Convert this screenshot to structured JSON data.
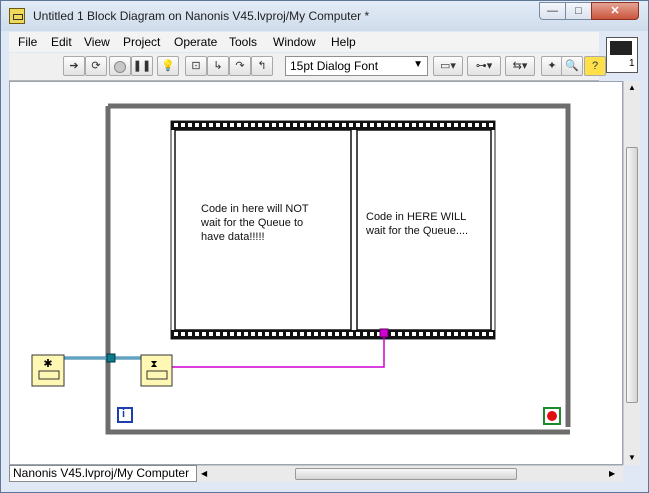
{
  "window": {
    "title": "Untitled 1 Block Diagram on Nanonis V45.lvproj/My Computer *",
    "controls": {
      "minimize": "—",
      "maximize": "□",
      "close": "✕"
    }
  },
  "menu": [
    "File",
    "Edit",
    "View",
    "Project",
    "Operate",
    "Tools",
    "Window",
    "Help"
  ],
  "toolbar": {
    "font_selector": "15pt Dialog Font",
    "icons": [
      "run-arrow-icon",
      "run-continuously-icon",
      "abort-icon",
      "pause-icon",
      "highlight-execution-icon",
      "retain-wire-values-icon",
      "step-into-icon",
      "step-over-icon",
      "step-out-icon",
      "align-objects-icon",
      "distribute-objects-icon",
      "reorder-icon",
      "cleanup-diagram-icon",
      "context-help-icon"
    ]
  },
  "diagram": {
    "frame_left_text": "Code in here will NOT\nwait for the Queue to\nhave data!!!!!",
    "frame_right_text": "Code in HERE WILL\nwait for the Queue....",
    "loop_iteration_label": "i",
    "nodes": [
      "obtain-queue-node",
      "dequeue-element-node"
    ],
    "colors": {
      "loop_border": "#6d6d6d",
      "queue_wire": "#0c7a8a",
      "data_wire": "#d000d0",
      "node_fill": "#fff8b4",
      "stop_red": "#e01010"
    }
  },
  "status_bar": {
    "project_path": "Nanonis V45.lvproj/My Computer"
  }
}
